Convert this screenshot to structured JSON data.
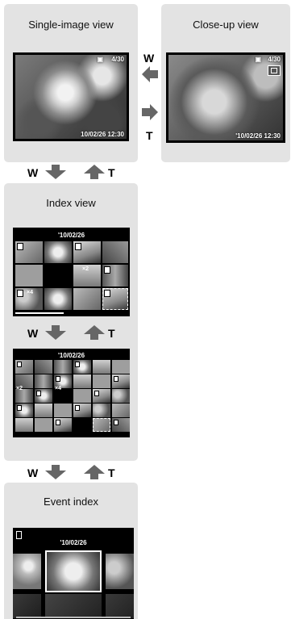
{
  "single_view": {
    "title": "Single-image view",
    "file_counter": "4/30",
    "datetime": "10/02/26  12:30"
  },
  "closeup_view": {
    "title": "Close-up view",
    "file_counter": "4/30",
    "datetime": "'10/02/26  12:30"
  },
  "zoom_between_top": {
    "to_closeup_letter": "W",
    "to_single_letter": "T"
  },
  "zoom_to_index": {
    "w_letter": "W",
    "t_letter": "T"
  },
  "index_view": {
    "title": "Index view",
    "date_small": "'10/02/26",
    "date_large": "'10/02/26",
    "counts_small": [
      "×2",
      "×4"
    ],
    "counts_large": [
      "×2",
      "×4"
    ]
  },
  "zoom_inner": {
    "w_letter": "W",
    "t_letter": "T"
  },
  "zoom_to_event": {
    "w_letter": "W",
    "t_letter": "T"
  },
  "event_index": {
    "title": "Event index",
    "date": "'10/02/26"
  },
  "colors": {
    "panel_bg": "#e3e3e3",
    "screen_bg": "#000000",
    "arrow": "#666666"
  }
}
